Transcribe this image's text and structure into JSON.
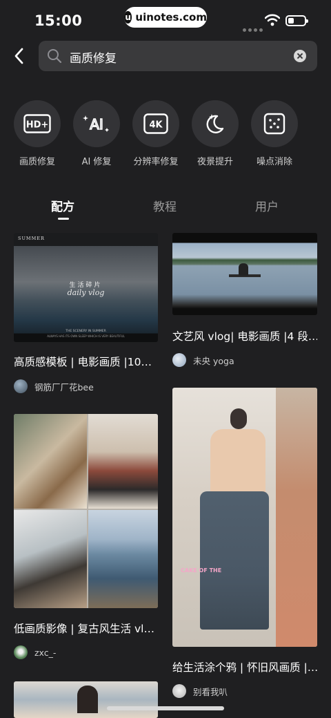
{
  "status_bar": {
    "time": "15:00",
    "watermark": "uinotes.com"
  },
  "search": {
    "query": "画质修复"
  },
  "tools": [
    {
      "icon": "hd-plus-icon",
      "label": "画质修复"
    },
    {
      "icon": "ai-sparkle-icon",
      "label": "AI 修复"
    },
    {
      "icon": "4k-icon",
      "label": "分辨率修复"
    },
    {
      "icon": "moon-sparkle-icon",
      "label": "夜景提升"
    },
    {
      "icon": "noise-dots-icon",
      "label": "噪点消除"
    }
  ],
  "tabs": [
    {
      "label": "配方",
      "active": true
    },
    {
      "label": "教程",
      "active": false
    },
    {
      "label": "用户",
      "active": false
    }
  ],
  "cards": {
    "c1": {
      "title": "高质感模板 | 电影画质 |10…",
      "user": "钢筋厂厂花bee",
      "thumb_text": {
        "summer": "SUMMER",
        "cn": "生活碎片",
        "script": "daily vlog",
        "foot1": "THE SCENERY IN SUMMER",
        "foot2": "ALWAYS HAS ITS OWN SLEEP WHICH IS VERY BEAUTIFUL"
      }
    },
    "c2": {
      "title": "文艺风 vlog| 电影画质 |4 段…",
      "user": "未央 yoga"
    },
    "c3": {
      "title": "低画质影像 | 复古风生活 vl…",
      "user": "zxc_-"
    },
    "c4": {
      "title": "给生活涂个鸦 | 怀旧风画质 |…",
      "user": "别看我叭",
      "sticker": "CAKE OF THE"
    }
  }
}
